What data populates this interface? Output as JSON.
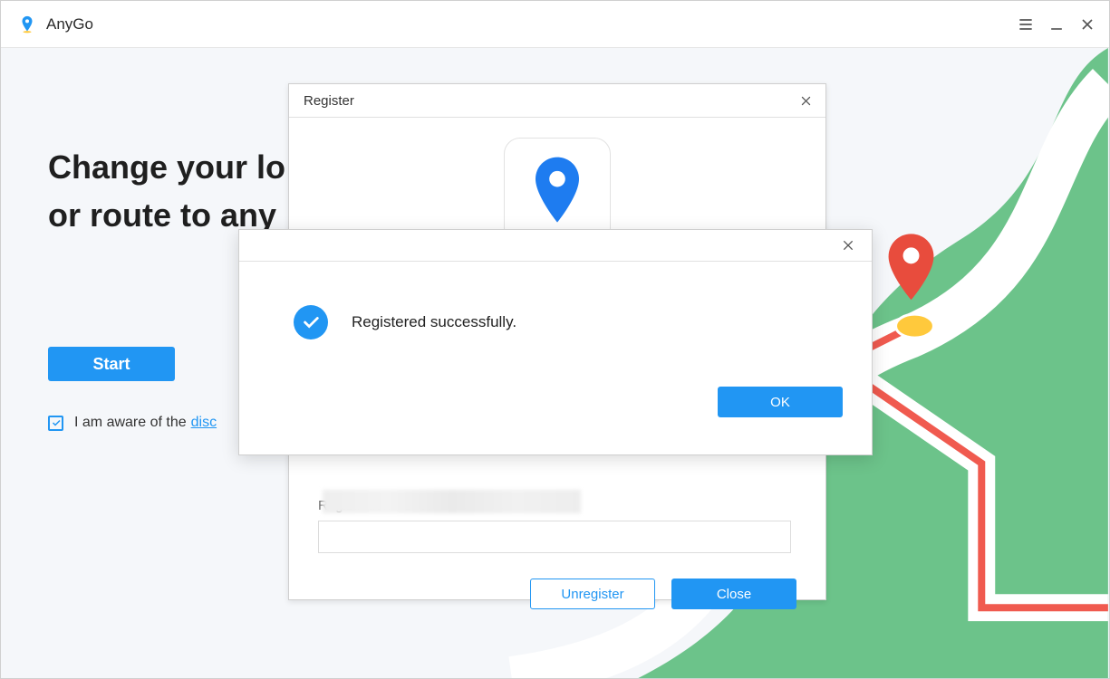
{
  "app": {
    "title": "AnyGo"
  },
  "main": {
    "headline_line1": "Change your lo",
    "headline_line2": "or route to any",
    "start_label": "Start",
    "disclaimer_prefix": "I am aware of the",
    "disclaimer_link": "disc"
  },
  "register_dialog": {
    "title": "Register",
    "code_label": "Registration Code:",
    "code_value": "",
    "unregister_label": "Unregister",
    "close_label": "Close"
  },
  "alert": {
    "message": "Registered successfully.",
    "ok_label": "OK"
  },
  "colors": {
    "accent": "#2196f3",
    "map_green": "#6cc38a",
    "route_red": "#f05a4f",
    "dot_yellow": "#ffc93c"
  }
}
